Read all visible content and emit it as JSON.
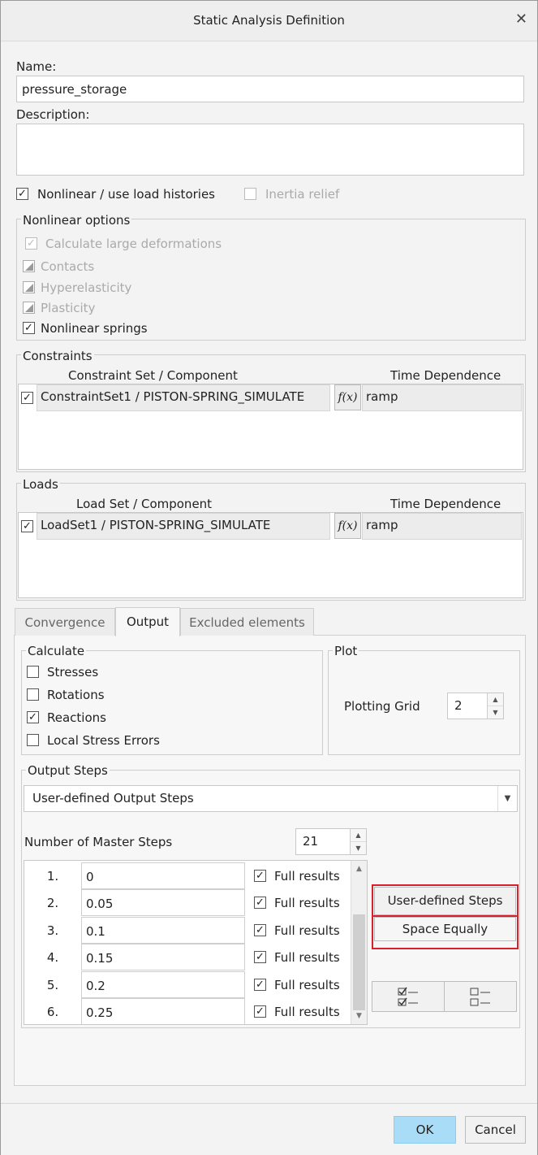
{
  "window": {
    "title": "Static Analysis Definition",
    "close_glyph": "✕"
  },
  "name": {
    "label": "Name:",
    "value": "pressure_storage"
  },
  "description": {
    "label": "Description:",
    "value": ""
  },
  "nonlinear": {
    "label": "Nonlinear / use load histories",
    "checked": true
  },
  "inertia_relief": {
    "label": "Inertia relief",
    "checked": false
  },
  "nonlinear_options": {
    "title": "Nonlinear options",
    "large_deformations": "Calculate large deformations",
    "contacts": "Contacts",
    "hyperelasticity": "Hyperelasticity",
    "plasticity": "Plasticity",
    "nonlinear_springs": "Nonlinear springs"
  },
  "constraints": {
    "title": "Constraints",
    "col_set": "Constraint Set / Component",
    "col_time": "Time Dependence",
    "row": {
      "set": "ConstraintSet1 / PISTON-SPRING_SIMULATE",
      "fx": "f(x)",
      "time": "ramp"
    }
  },
  "loads": {
    "title": "Loads",
    "col_set": "Load Set / Component",
    "col_time": "Time Dependence",
    "row": {
      "set": "LoadSet1 / PISTON-SPRING_SIMULATE",
      "fx": "f(x)",
      "time": "ramp"
    }
  },
  "tabs": {
    "convergence": "Convergence",
    "output": "Output",
    "excluded": "Excluded elements"
  },
  "calculate": {
    "title": "Calculate",
    "stresses": "Stresses",
    "rotations": "Rotations",
    "reactions": "Reactions",
    "local_stress_errors": "Local Stress Errors"
  },
  "plot": {
    "title": "Plot",
    "grid_label": "Plotting Grid",
    "grid_value": "2"
  },
  "output_steps": {
    "title": "Output Steps",
    "mode": "User-defined Output Steps",
    "master_label": "Number of Master Steps",
    "master_value": "21",
    "full_results": "Full results",
    "steps": [
      {
        "num": "1.",
        "value": "0"
      },
      {
        "num": "2.",
        "value": "0.05"
      },
      {
        "num": "3.",
        "value": "0.1"
      },
      {
        "num": "4.",
        "value": "0.15"
      },
      {
        "num": "5.",
        "value": "0.2"
      },
      {
        "num": "6.",
        "value": "0.25"
      }
    ],
    "user_defined_btn": "User-defined Steps",
    "space_equally_btn": "Space Equally"
  },
  "footer": {
    "ok": "OK",
    "cancel": "Cancel"
  },
  "colors": {
    "highlight": "#d8222b",
    "ok_button": "#a9dcf6"
  }
}
